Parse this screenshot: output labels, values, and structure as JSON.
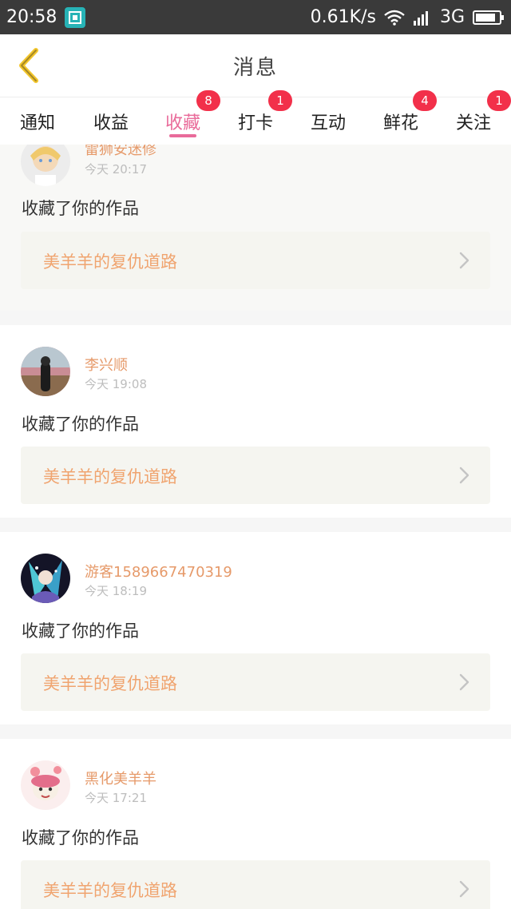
{
  "status_bar": {
    "time": "20:58",
    "speed": "0.61K/s",
    "network": "3G"
  },
  "header": {
    "title": "消息"
  },
  "tabs": [
    {
      "label": "通知",
      "badge": ""
    },
    {
      "label": "收益",
      "badge": ""
    },
    {
      "label": "收藏",
      "badge": "8"
    },
    {
      "label": "打卡",
      "badge": "1"
    },
    {
      "label": "互动",
      "badge": ""
    },
    {
      "label": "鲜花",
      "badge": "4"
    },
    {
      "label": "关注",
      "badge": "1"
    }
  ],
  "active_tab": "收藏",
  "colors": {
    "accent": "#e96b9a",
    "badge": "#f2304a",
    "username": "#e69a6a",
    "work_title": "#f0a46f"
  },
  "messages": [
    {
      "username": "雷狮安迷修",
      "time": "今天 20:17",
      "action": "收藏了你的作品",
      "work_title": "美羊羊的复仇道路"
    },
    {
      "username": "李兴顺",
      "time": "今天 19:08",
      "action": "收藏了你的作品",
      "work_title": "美羊羊的复仇道路"
    },
    {
      "username": "游客1589667470319",
      "time": "今天 18:19",
      "action": "收藏了你的作品",
      "work_title": "美羊羊的复仇道路"
    },
    {
      "username": "黑化美羊羊",
      "time": "今天 17:21",
      "action": "收藏了你的作品",
      "work_title": "美羊羊的复仇道路"
    }
  ]
}
